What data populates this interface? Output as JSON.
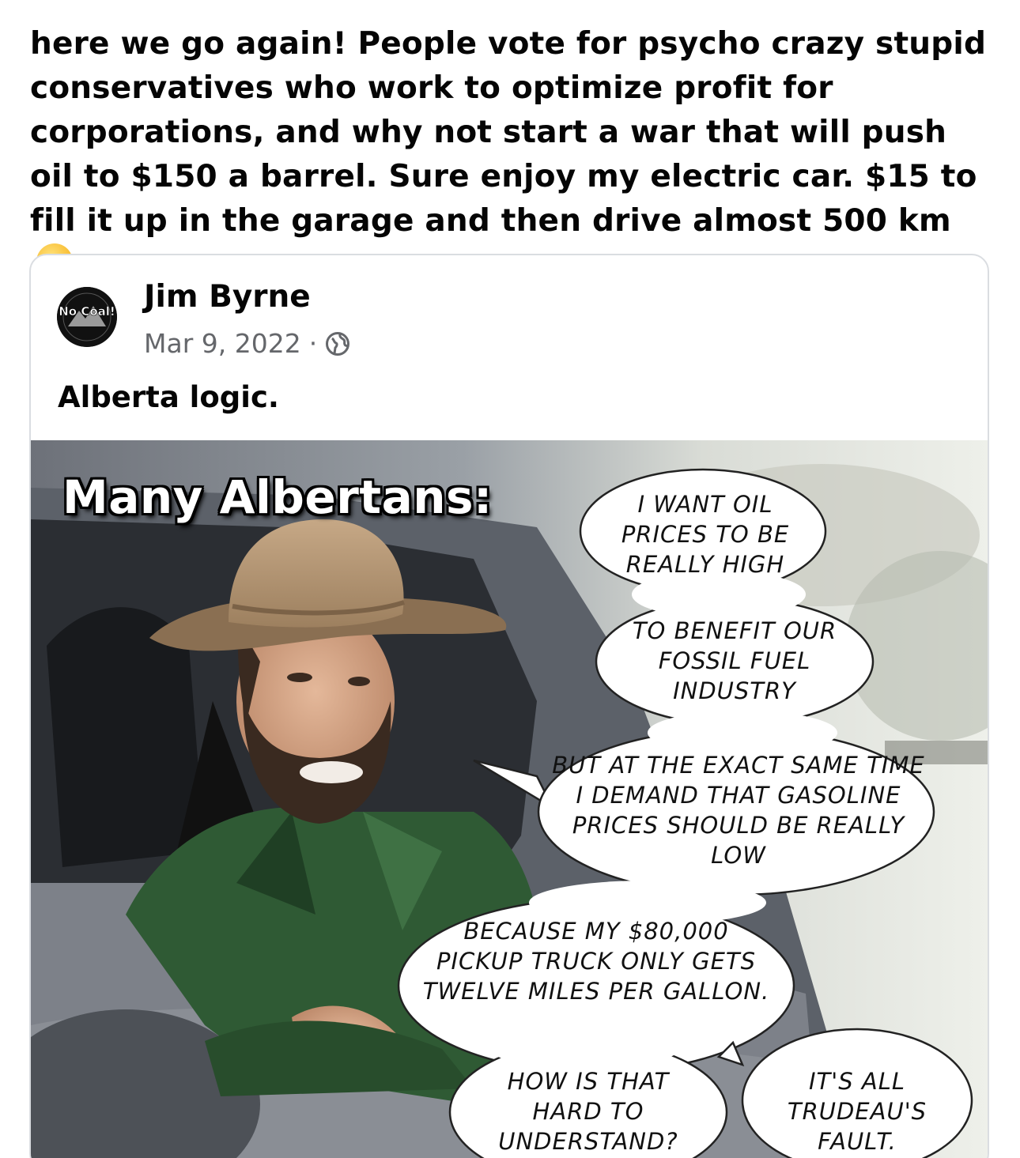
{
  "post": {
    "text": "here we go again! People vote for psycho crazy stupid conservatives who work to optimize profit for corporations, and why not start a war that will push oil to $150 a barrel. Sure enjoy my electric car. $15 to fill it up in the garage and then drive almost 500 km",
    "emoji_icon": "smiling-face-icon"
  },
  "shared_post": {
    "author": "Jim Byrne",
    "date": "Mar 9, 2022",
    "separator": "·",
    "privacy_icon": "globe-icon",
    "caption": "Alberta logic.",
    "avatar": {
      "icon": "no-coal-logo",
      "text": "No Coal!"
    },
    "meme": {
      "title": "Many Albertans:",
      "bubbles": [
        "I want oil prices to be really high",
        "To benefit our fossil fuel industry",
        "But at the exact same time I demand that gasoline prices should be really low",
        "Because my $80,000 pickup truck only gets twelve miles per gallon.",
        "How is that hard to understand?",
        "It's all Trudeau's fault."
      ]
    }
  }
}
